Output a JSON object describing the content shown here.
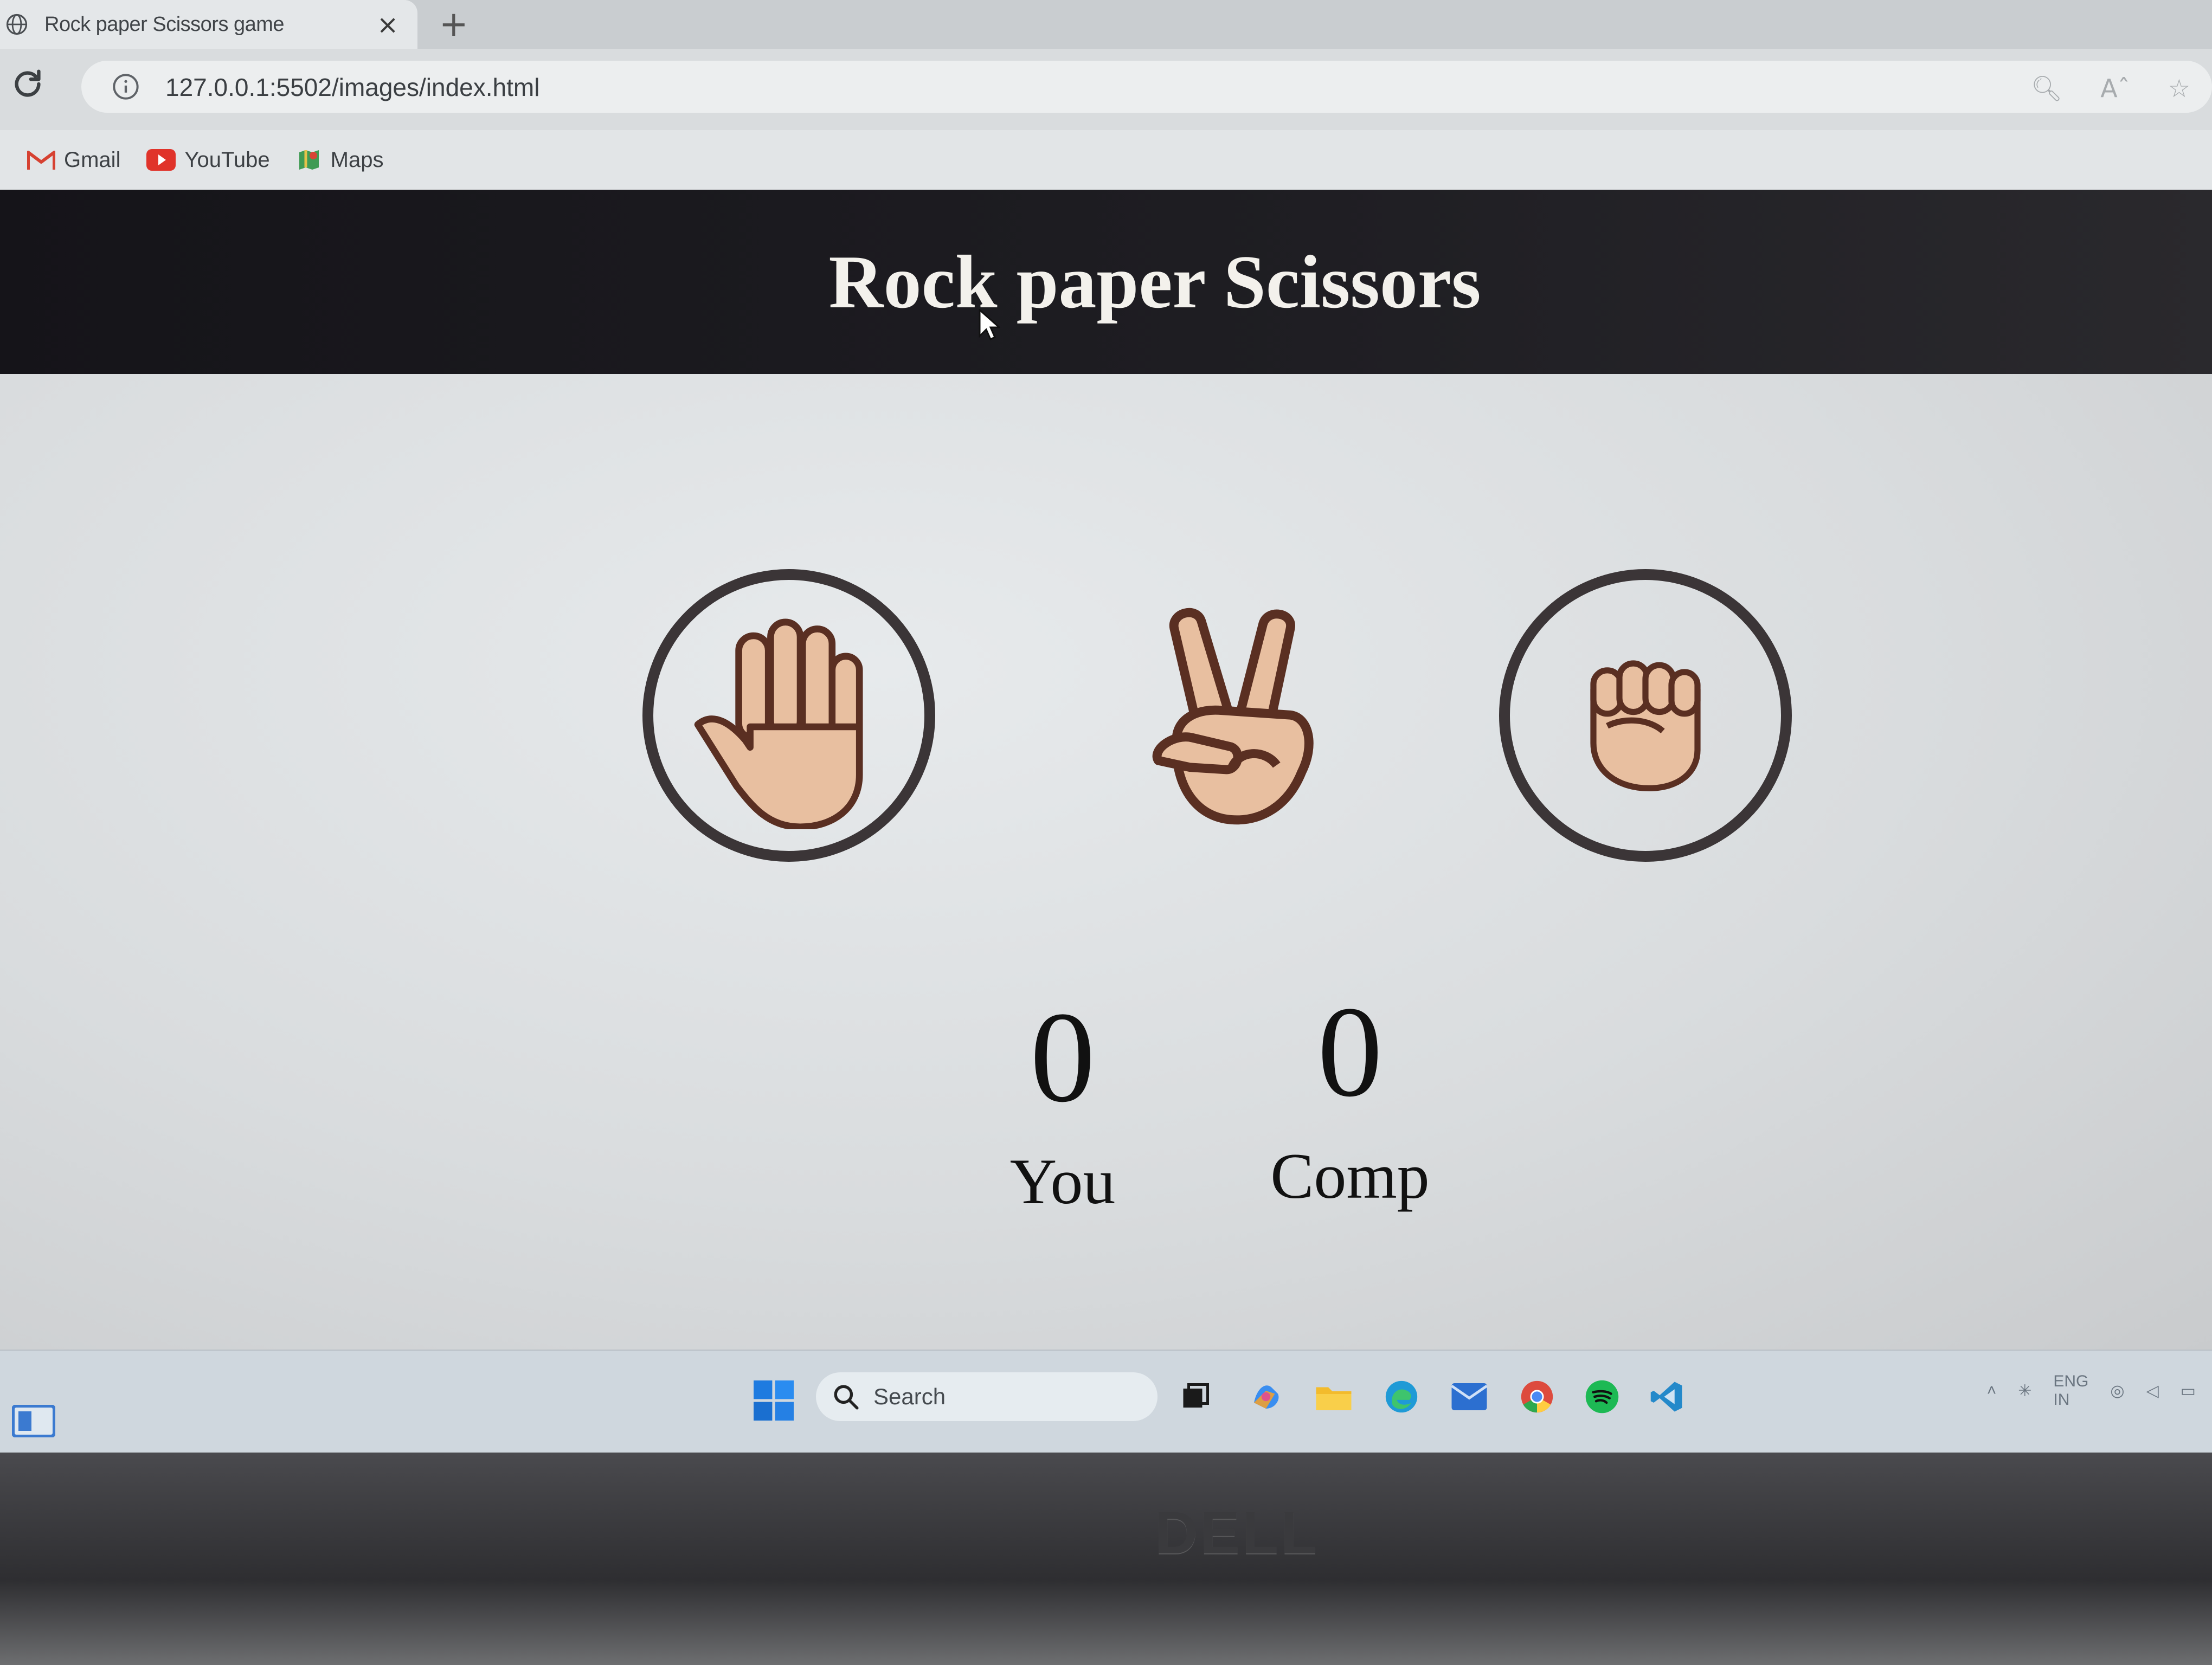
{
  "browser": {
    "tab_title": "Rock paper Scissors game",
    "tab_close": "×",
    "new_tab": "+",
    "url": "127.0.0.1:5502/images/index.html",
    "bookmarks": [
      {
        "label": "Gmail",
        "icon": "gmail-icon"
      },
      {
        "label": "YouTube",
        "icon": "youtube-icon"
      },
      {
        "label": "Maps",
        "icon": "maps-icon"
      }
    ]
  },
  "page": {
    "title": "Rock paper Scissors",
    "choices": [
      {
        "name": "paper",
        "icon": "raised-hand-icon"
      },
      {
        "name": "scissors",
        "icon": "victory-hand-icon"
      },
      {
        "name": "rock",
        "icon": "raised-fist-icon"
      }
    ],
    "scores": {
      "user_score": "0",
      "user_label": "You",
      "comp_score": "0",
      "comp_label": "Comp"
    }
  },
  "taskbar": {
    "search_label": "Search",
    "tray_lang_line1": "ENG",
    "tray_lang_line2": "IN"
  },
  "device": {
    "brand": "DELL"
  },
  "colors": {
    "header_bg": "#1a191e",
    "ring": "#3b3537",
    "skin": "#e8bfa0",
    "outline": "#5a2f22"
  }
}
